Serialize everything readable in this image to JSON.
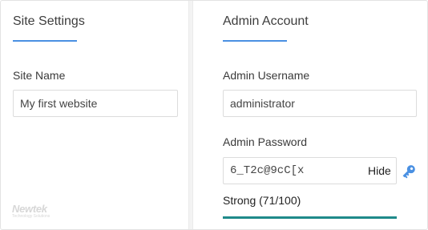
{
  "site_settings": {
    "title": "Site Settings",
    "site_name_label": "Site Name",
    "site_name_value": "My first website"
  },
  "admin_account": {
    "title": "Admin Account",
    "username_label": "Admin Username",
    "username_value": "administrator",
    "password_label": "Admin Password",
    "password_value": "6_T2c@9cC[x",
    "hide_label": "Hide",
    "strength_text": "Strong (71/100)",
    "strength_score": 71,
    "strength_color": "#1f8a8a"
  },
  "branding": {
    "logo_text": "Newtek",
    "logo_subtext": "Technology Solutions"
  },
  "colors": {
    "accent": "#4a90e2",
    "key_icon": "#4a90e2"
  }
}
